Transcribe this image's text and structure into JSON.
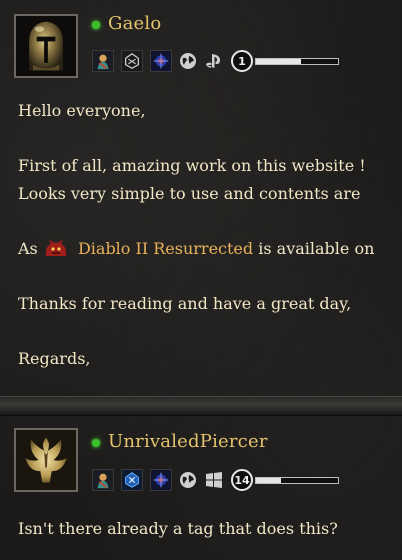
{
  "posts": [
    {
      "username": "Gaelo",
      "level": "1",
      "level_progress": 0.55,
      "badges": [
        "character-badge-icon",
        "diablo-emblem-badge-icon",
        "rune-badge-icon"
      ],
      "platforms": [
        "globe-icon",
        "playstation-icon"
      ],
      "body": {
        "greeting": "Hello everyone,",
        "line1": "First of all, amazing work on this website !",
        "line2": "Looks very simple to use and contents are",
        "line3_prefix": "As",
        "line3_game": "Diablo II Resurrected",
        "line3_suffix": "is available on",
        "thanks": "Thanks for reading and have a great day,",
        "regards": "Regards,"
      }
    },
    {
      "username": "UnrivaledPiercer",
      "level": "14",
      "level_progress": 0.3,
      "badges": [
        "character-badge-icon",
        "diablo-emblem-badge-icon",
        "rune-badge-icon"
      ],
      "platforms": [
        "globe-icon",
        "windows-icon"
      ],
      "body": {
        "line1": "Isn't there already a tag that does this?"
      }
    }
  ],
  "colors": {
    "username": "#e5c46e",
    "body_text": "#f2e6c6",
    "online": "#3ec22b",
    "game_link": "#e8b15c"
  }
}
